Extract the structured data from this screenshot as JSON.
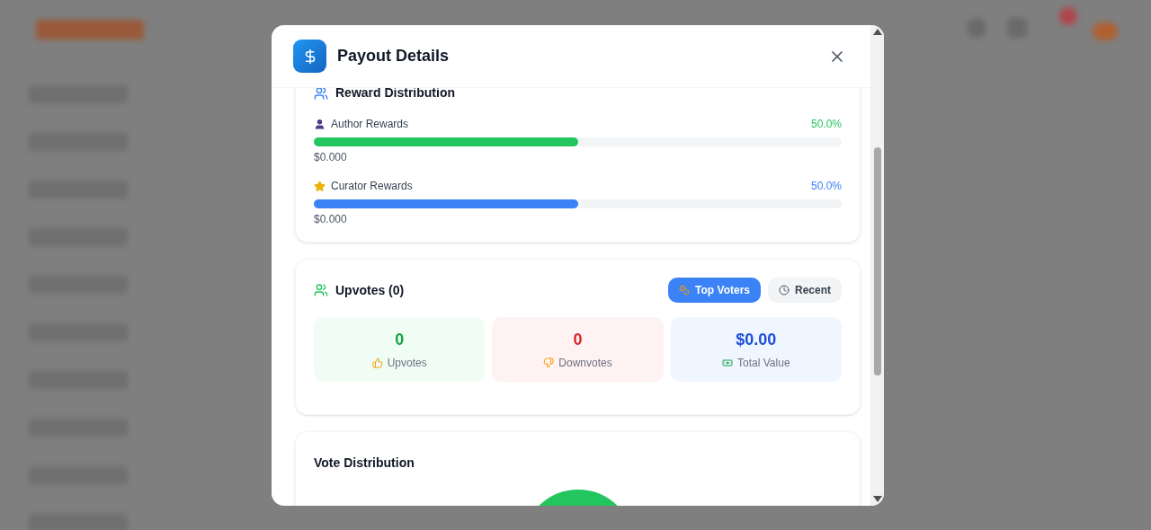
{
  "dialog": {
    "title": "Payout Details"
  },
  "reward_distribution": {
    "title": "Reward Distribution",
    "items": [
      {
        "kind": "author",
        "label": "Author Rewards",
        "percent": "50.0%",
        "level": 0.5,
        "amount": "$0.000",
        "color": "#22c55e"
      },
      {
        "kind": "curator",
        "label": "Curator Rewards",
        "percent": "50.0%",
        "level": 0.5,
        "amount": "$0.000",
        "color": "#3b82f6"
      }
    ]
  },
  "upvotes": {
    "title": "Upvotes (0)",
    "tabs": [
      {
        "kind": "top",
        "label": "Top Voters",
        "selected": true
      },
      {
        "kind": "recent",
        "label": "Recent",
        "selected": false
      }
    ],
    "stats": [
      {
        "kind": "up",
        "value": "0",
        "label": "Upvotes"
      },
      {
        "kind": "down",
        "value": "0",
        "label": "Downvotes"
      },
      {
        "kind": "total",
        "value": "$0.00",
        "label": "Total Value"
      }
    ]
  },
  "vote_distribution": {
    "title": "Vote Distribution"
  }
}
